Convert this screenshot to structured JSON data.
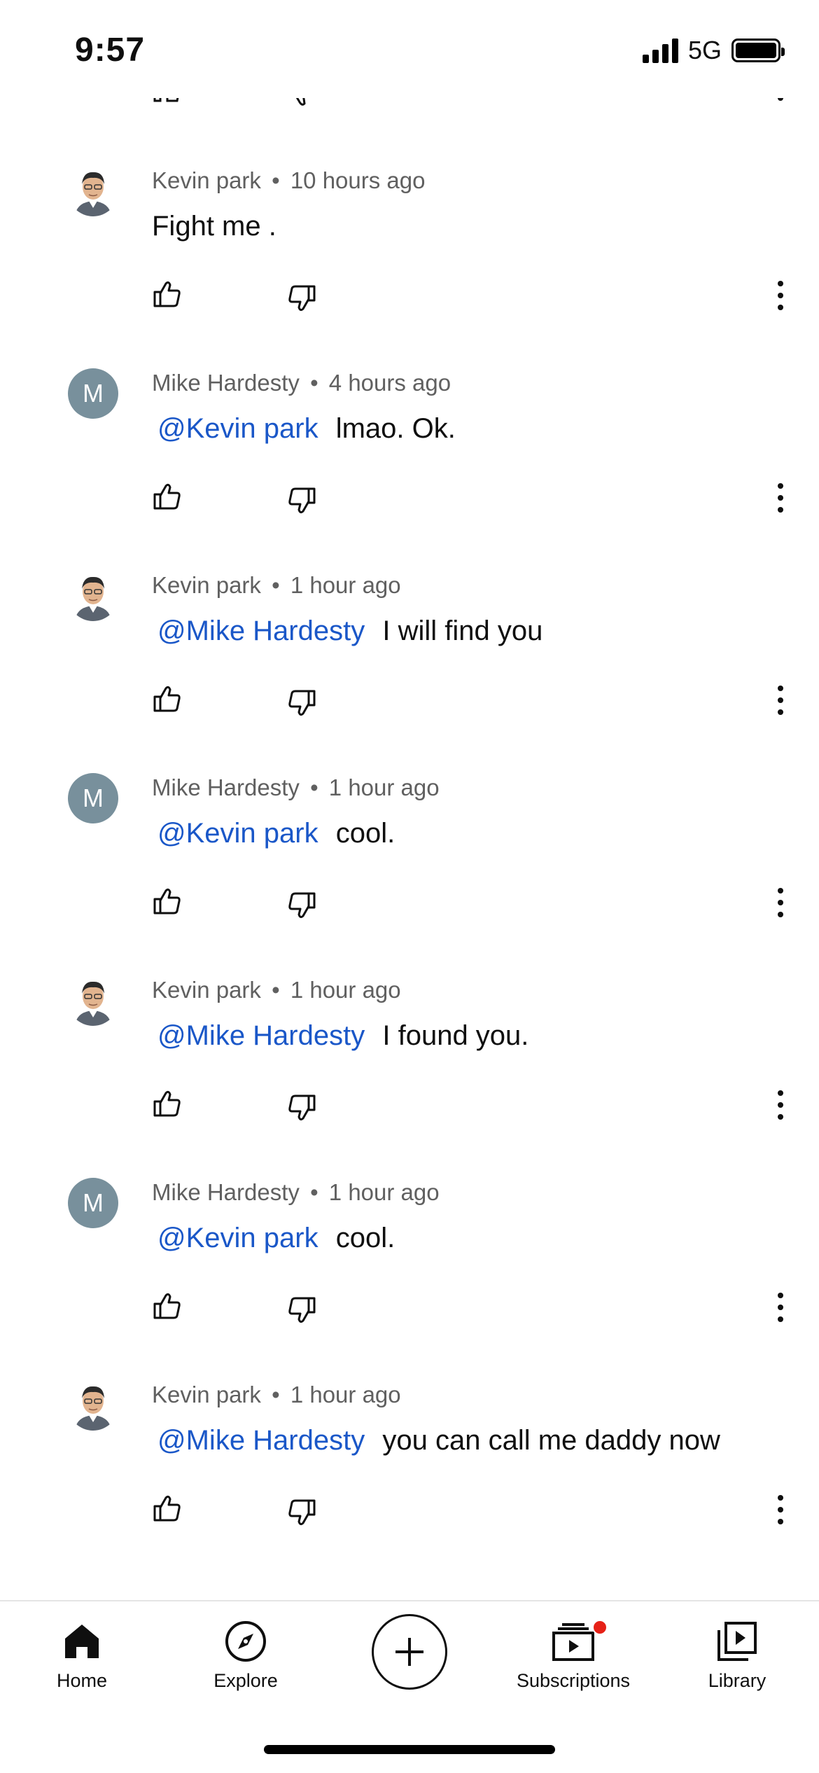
{
  "status_bar": {
    "time": "9:57",
    "network": "5G"
  },
  "comments": [
    {
      "author": "Kevin park",
      "time": "10 hours ago",
      "mention": "",
      "text": "Fight me .",
      "avatar_type": "photo"
    },
    {
      "author": "Mike Hardesty",
      "time": "4 hours ago",
      "mention": "@Kevin park",
      "text": "lmao. Ok.",
      "avatar_type": "letter",
      "avatar_letter": "M"
    },
    {
      "author": "Kevin park",
      "time": "1 hour ago",
      "mention": "@Mike Hardesty",
      "text": "I will find you",
      "avatar_type": "photo"
    },
    {
      "author": "Mike Hardesty",
      "time": "1 hour ago",
      "mention": "@Kevin park",
      "text": "cool.",
      "avatar_type": "letter",
      "avatar_letter": "M"
    },
    {
      "author": "Kevin park",
      "time": "1 hour ago",
      "mention": "@Mike Hardesty",
      "text": "I found you.",
      "avatar_type": "photo"
    },
    {
      "author": "Mike Hardesty",
      "time": "1 hour ago",
      "mention": "@Kevin park",
      "text": "cool.",
      "avatar_type": "letter",
      "avatar_letter": "M"
    },
    {
      "author": "Kevin park",
      "time": "1 hour ago",
      "mention": "@Mike Hardesty",
      "text": "you can call me daddy now",
      "avatar_type": "photo"
    }
  ],
  "separator": "•",
  "nav": {
    "home": "Home",
    "explore": "Explore",
    "subscriptions": "Subscriptions",
    "library": "Library"
  },
  "colors": {
    "mention": "#1a57c8",
    "avatar_letter_bg": "#78909c",
    "badge": "#e62117"
  }
}
